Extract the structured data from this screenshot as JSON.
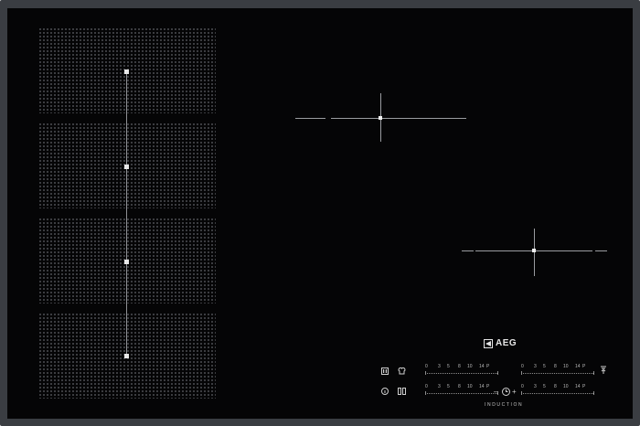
{
  "brand": {
    "name": "AEG",
    "subtitle": "INDUCTION"
  },
  "hob": {
    "flex_zone_count": 4,
    "markers": 4,
    "scale_labels": [
      "0",
      "3",
      "5",
      "8",
      "10",
      "14",
      "P"
    ]
  },
  "controls": {
    "left_top_icon": "pause-icon",
    "left_top2_icon": "chef-hat-icon",
    "left_mid_icon": "bridge-icon",
    "left_bottom_icon": "info-icon",
    "minus": "–",
    "plus": "+",
    "timer_icon": "timer-icon",
    "right_icon": "hob2hood-icon"
  },
  "colors": {
    "glass": "#050506",
    "frame": "#3a3d42",
    "lines": "#9a9ca0"
  }
}
